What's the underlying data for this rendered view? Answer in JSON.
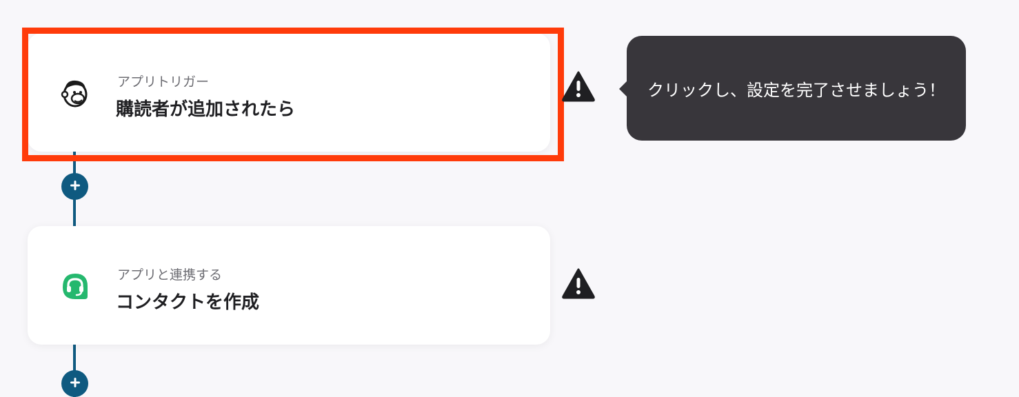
{
  "steps": [
    {
      "subtitle": "アプリトリガー",
      "title": "購読者が追加されたら",
      "icon": "mailchimp-icon"
    },
    {
      "subtitle": "アプリと連携する",
      "title": "コンタクトを作成",
      "icon": "freshdesk-icon"
    }
  ],
  "tooltip": {
    "text": "クリックし、設定を完了させましょう！"
  },
  "colors": {
    "accent": "#0f5a80",
    "highlight": "#ff3b0a",
    "tooltip_bg": "#38363b",
    "app_green": "#25b86e"
  }
}
